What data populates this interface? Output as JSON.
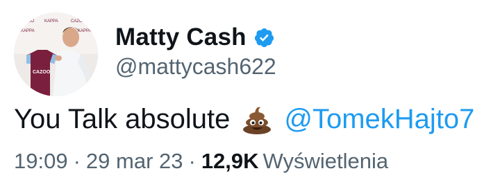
{
  "author": {
    "name": "Matty Cash",
    "handle": "@mattycash622",
    "verified_color": "#1d9bf0",
    "avatar_jersey_text": "CAZOO"
  },
  "tweet": {
    "text": "You Talk absolute",
    "emoji": "poop-emoji",
    "mention": "@TomekHajto7"
  },
  "meta": {
    "time": "19:09",
    "separator": "·",
    "date": "29 mar 23",
    "views_count": "12,9K",
    "views_label": "Wyświetlenia"
  },
  "colors": {
    "text": "#0f1419",
    "secondary": "#536471",
    "link": "#1d9bf0",
    "jersey": "#7a1f3d"
  }
}
